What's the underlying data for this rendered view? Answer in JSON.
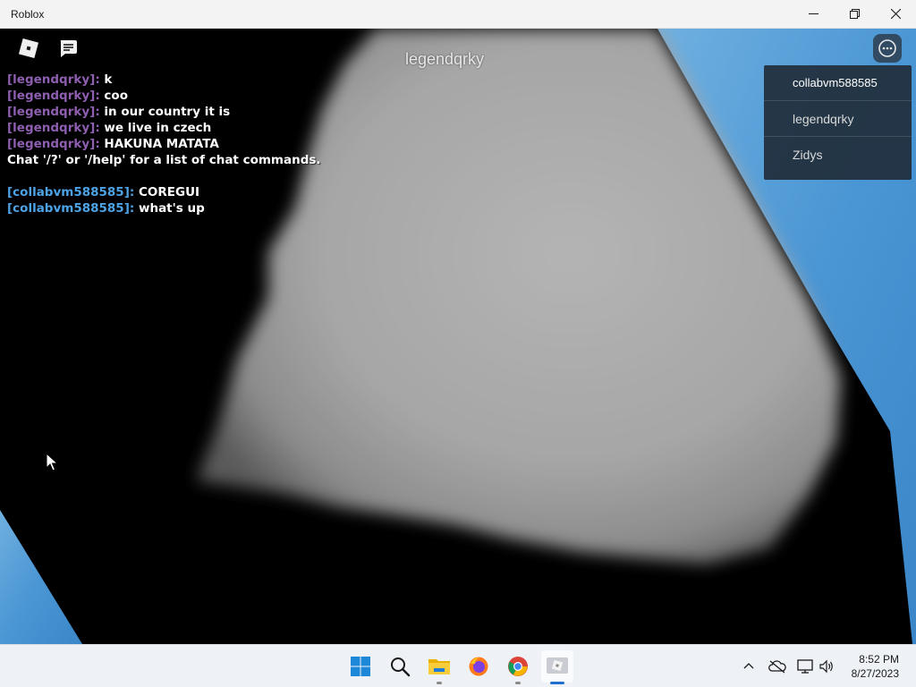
{
  "window": {
    "title": "Roblox",
    "minimize_icon": "minimize-icon",
    "restore_icon": "restore-icon",
    "close_icon": "close-icon"
  },
  "game": {
    "overhead_name": "legendqrky",
    "roblox_menu_icon": "roblox-logo-icon",
    "chat_toggle_icon": "chat-bubble-icon",
    "more_options_icon": "ellipsis-icon"
  },
  "chat": {
    "messages": [
      {
        "name": "[legendqrky]:",
        "text": "k"
      },
      {
        "name": "[legendqrky]:",
        "text": "coo"
      },
      {
        "name": "[legendqrky]:",
        "text": "in our country it is"
      },
      {
        "name": "[legendqrky]:",
        "text": "we live in czech"
      },
      {
        "name": "[legendqrky]:",
        "text": "HAKUNA MATATA"
      }
    ],
    "system_message": "Chat '/?' or '/help' for a list of chat commands.",
    "messages2": [
      {
        "name": "[collabvm588585]:",
        "text": "COREGUI"
      },
      {
        "name": "[collabvm588585]:",
        "text": "what's up"
      }
    ],
    "colors": {
      "legendqrky": "#8e5fb0",
      "collabvm": "#4da3e6"
    }
  },
  "playerlist": {
    "players": [
      "collabvm588585",
      "legendqrky",
      "Zidys"
    ]
  },
  "taskbar": {
    "apps": [
      "windows-start-icon",
      "search-icon",
      "file-explorer-icon",
      "firefox-icon",
      "chrome-icon",
      "roblox-app-icon"
    ],
    "tray": [
      "chevron-up-icon",
      "onedrive-offline-icon",
      "network-icon",
      "volume-icon"
    ],
    "time": "8:52 PM",
    "date": "8/27/2023"
  }
}
